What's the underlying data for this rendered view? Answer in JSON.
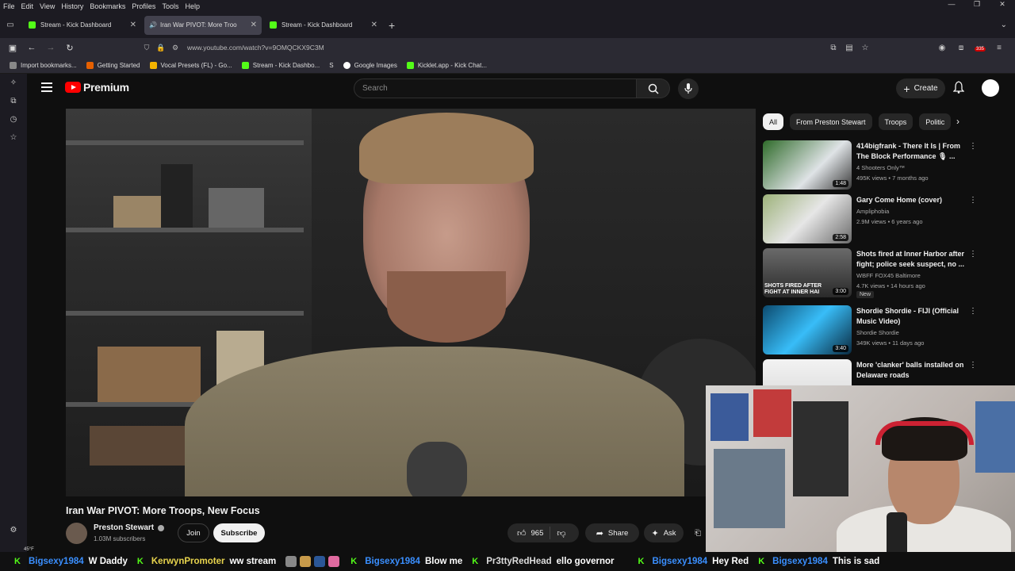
{
  "browser": {
    "menu": [
      "File",
      "Edit",
      "View",
      "History",
      "Bookmarks",
      "Profiles",
      "Tools",
      "Help"
    ],
    "tabs": [
      {
        "title": "Stream - Kick Dashboard"
      },
      {
        "title": "Iran War PIVOT: More Troo"
      },
      {
        "title": "Stream - Kick Dashboard"
      }
    ],
    "url": "www.youtube.com/watch?v=9OMQCKX9C3M",
    "ext_badge": "335",
    "bookmarks": [
      "Import bookmarks...",
      "Getting Started",
      "Vocal Presets (FL) - Go...",
      "Stream - Kick Dashbo...",
      "S",
      "Google Images",
      "Kicklet.app - Kick Chat..."
    ]
  },
  "youtube": {
    "logo": "Premium",
    "search_placeholder": "Search",
    "create_label": "Create",
    "video": {
      "title": "Iran War PIVOT: More Troops, New Focus",
      "channel": "Preston Stewart",
      "subscribers": "1.03M subscribers",
      "join": "Join",
      "subscribe": "Subscribe",
      "likes": "965",
      "share": "Share",
      "ask": "Ask"
    },
    "chips": [
      "All",
      "From Preston Stewart",
      "Troops",
      "Politic"
    ],
    "recommendations": [
      {
        "title": "414bigfrank - There It Is | From The Block Performance 🎙 ...",
        "channel": "4 Shooters Only™",
        "meta": "495K views • 7 months ago",
        "duration": "1:48"
      },
      {
        "title": "Gary Come Home (cover)",
        "channel": "Ampliphobia",
        "meta": "2.9M views • 6 years ago",
        "duration": "2:58"
      },
      {
        "title": "Shots fired at Inner Harbor after fight; police seek suspect, no ...",
        "channel": "WBFF FOX45 Baltimore",
        "meta": "4.7K views • 14 hours ago",
        "duration": "3:00",
        "badge": "New",
        "thumb_text": "SHOTS FIRED AFTER FIGHT AT INNER HAI"
      },
      {
        "title": "Shordie Shordie - FIJI (Official Music Video)",
        "channel": "Shordie Shordie",
        "meta": "349K views • 11 days ago",
        "duration": "3:40"
      },
      {
        "title": "More 'clanker' balls installed on Delaware roads",
        "channel": "",
        "meta": "",
        "duration": ""
      }
    ]
  },
  "overlay": {
    "weather": "45°F",
    "chat": [
      {
        "user": "Bigsexy1984",
        "msg": "W Daddy"
      },
      {
        "user": "KerwynPromoter",
        "msg": "ww stream"
      },
      {
        "user": "Bigsexy1984",
        "msg": "Blow me"
      },
      {
        "user": "Pr3ttyRedHead",
        "msg": "ello governor"
      },
      {
        "user": "Bigsexy1984",
        "msg": "Hey Red"
      },
      {
        "user": "Bigsexy1984",
        "msg": "This is sad"
      }
    ]
  }
}
